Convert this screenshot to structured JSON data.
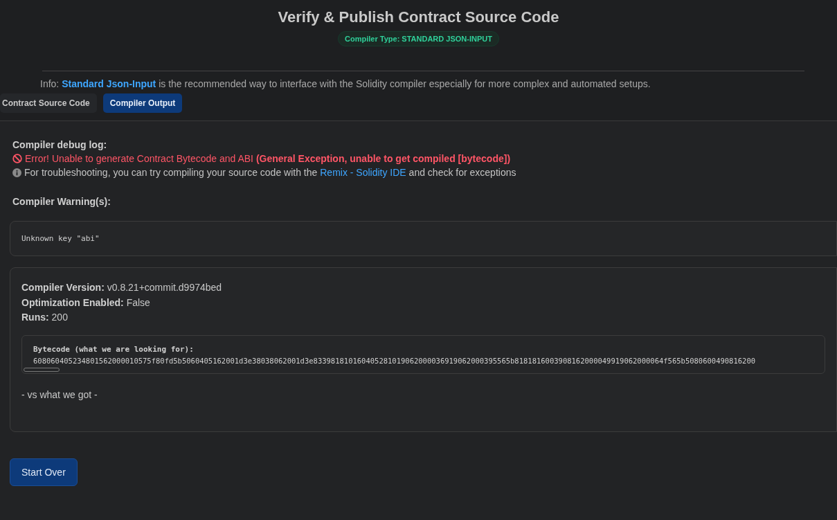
{
  "header": {
    "title": "Verify & Publish Contract Source Code",
    "badge": "Compiler Type: STANDARD JSON-INPUT"
  },
  "info": {
    "label": "Info:",
    "link": "Standard Json-Input",
    "text": "is the recommended way to interface with the Solidity compiler especially for more complex and automated setups."
  },
  "tabs": [
    {
      "label": "Contract Source Code",
      "selected": false
    },
    {
      "label": "Compiler Output",
      "selected": true
    }
  ],
  "debug_log": {
    "heading": "Compiler debug log:",
    "error": "Error! Unable to generate Contract Bytecode and ABI **(General Exception, unable to get compiled [bytecode])**",
    "hint_before": "For troubleshooting, you can try compiling your source code with the",
    "hint_link": "Remix - Solidity IDE",
    "hint_after": "and check for exceptions"
  },
  "warnings": {
    "heading": "Compiler Warning(s):",
    "text": "Unknown key \"abi\""
  },
  "details": [
    {
      "label": "Compiler Version:",
      "value": "v0.8.21+commit.d9974bed"
    },
    {
      "label": "Optimization Enabled:",
      "value": "False"
    },
    {
      "label": "Runs:",
      "value": "200"
    }
  ],
  "bytecode": {
    "heading": "Bytecode (what we are looking for):",
    "value": "608060405234801562000010575f80fd5b5060405162001d3e38038062001d3e833981810160405281019062000036919062000395565b8181816003908162000049919062000064f565b5080600490816200"
  },
  "comparison": "- vs what we got -",
  "start_over": "Start Over"
}
